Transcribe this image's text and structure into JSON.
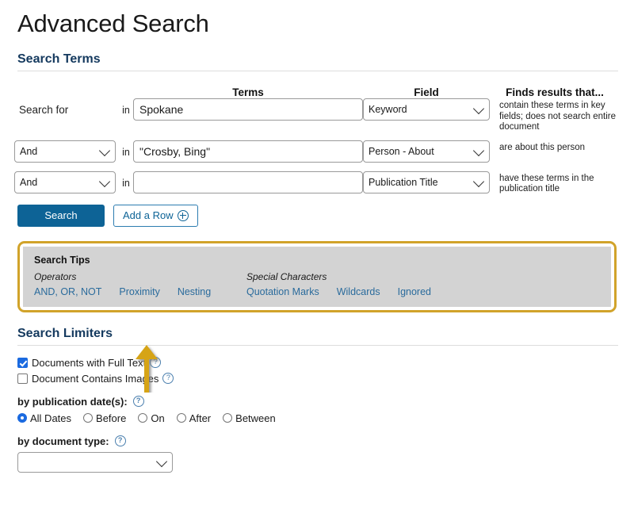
{
  "page": {
    "title": "Advanced Search"
  },
  "search_terms": {
    "heading": "Search Terms",
    "columns": {
      "terms": "Terms",
      "field": "Field",
      "finds": "Finds results that..."
    },
    "in_label": "in",
    "rows": [
      {
        "lead_label": "Search for",
        "operator": null,
        "term_value": "Spokane",
        "term_placeholder": "",
        "field": "Keyword",
        "description": "contain these terms in key fields; does not search entire document"
      },
      {
        "lead_label": "",
        "operator": "And",
        "term_value": "\"Crosby, Bing\"",
        "term_placeholder": "",
        "field": "Person - About",
        "description": "are about this person"
      },
      {
        "lead_label": "",
        "operator": "And",
        "term_value": "",
        "term_placeholder": "",
        "field": "Publication Title",
        "description": "have these terms in the publication title"
      }
    ],
    "search_button": "Search",
    "add_row_button": "Add a Row"
  },
  "search_tips": {
    "title": "Search Tips",
    "groups": [
      {
        "subtitle": "Operators",
        "links": [
          "AND, OR, NOT",
          "Proximity",
          "Nesting"
        ]
      },
      {
        "subtitle": "Special Characters",
        "links": [
          "Quotation Marks",
          "Wildcards",
          "Ignored"
        ]
      }
    ],
    "border_color": "#d1a32a",
    "panel_color": "#d3d3d3"
  },
  "search_limiters": {
    "heading": "Search Limiters",
    "checkboxes": [
      {
        "label": "Documents with Full Text",
        "checked": true
      },
      {
        "label": "Document Contains Images",
        "checked": false
      }
    ],
    "publication_date": {
      "label": "by publication date(s):",
      "options": [
        "All Dates",
        "Before",
        "On",
        "After",
        "Between"
      ],
      "selected": "All Dates"
    },
    "document_type": {
      "label": "by document type:",
      "value": ""
    }
  },
  "annotation": {
    "arrow_color": "#d6a417",
    "arrow_direction": "up"
  },
  "theme": {
    "heading_color": "#14395e",
    "link_color": "#2a6b9c",
    "primary_button": "#0d6396"
  }
}
